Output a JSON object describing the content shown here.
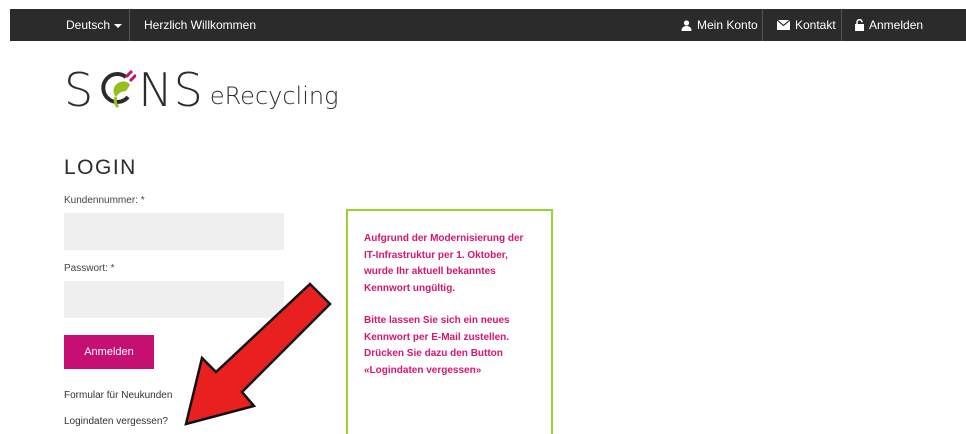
{
  "topbar": {
    "language": "Deutsch",
    "welcome": "Herzlich Willkommen",
    "account": "Mein Konto",
    "contact": "Kontakt",
    "login": "Anmelden",
    "icons": [
      "user-icon",
      "envelope-icon",
      "lock-icon"
    ]
  },
  "logo": {
    "brand": "S NS",
    "brand_left": "S",
    "brand_right": "NS",
    "sub": "eRecycling"
  },
  "login": {
    "title": "LOGIN",
    "customer_label": "Kundennummer: *",
    "customer_value": "",
    "password_label": "Passwort: *",
    "password_value": "",
    "submit": "Anmelden",
    "new_customer_link": "Formular für Neukunden",
    "forgot_link": "Logindaten vergessen?"
  },
  "notice": {
    "paragraph1": "Aufgrund der Modernisierung der IT-Infrastruktur per 1. Oktober, wurde Ihr aktuell bekanntes Kennwort ungültig.",
    "paragraph2": "Bitte lassen Sie sich ein neues Kennwort per E-Mail zustellen. Drücken Sie dazu den Button «Logindaten vergessen»"
  },
  "colors": {
    "topbar": "#2b2b2b",
    "accent": "#c60f73",
    "notice_border": "#9bd12b",
    "notice_text": "#d6166f",
    "arrow": "#e8201f"
  }
}
